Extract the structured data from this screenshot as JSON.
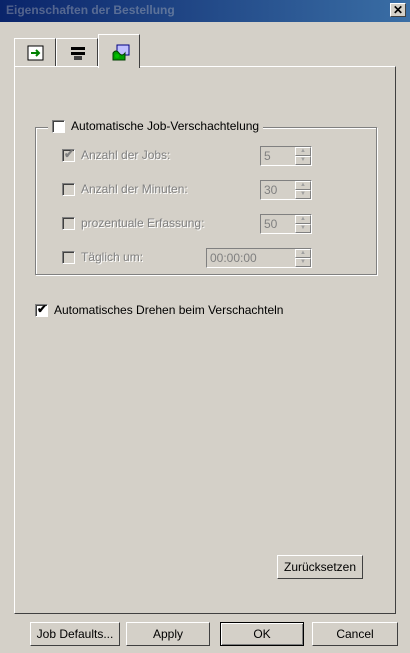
{
  "window": {
    "title": "Eigenschaften der Bestellung",
    "close_symbol": "✕"
  },
  "tabs": [
    {
      "icon": "document-arrow-icon"
    },
    {
      "icon": "printer-icon"
    },
    {
      "icon": "puzzle-settings-icon",
      "active": true
    }
  ],
  "auto_nesting": {
    "label": "Automatische Job-Verschachtelung",
    "checked": false,
    "options": [
      {
        "label": "Anzahl der Jobs:",
        "checked": true,
        "value": "5"
      },
      {
        "label": "Anzahl der Minuten:",
        "checked": false,
        "value": "30"
      },
      {
        "label": "prozentuale Erfassung:",
        "checked": false,
        "value": "50"
      },
      {
        "label": "Täglich um:",
        "checked": false,
        "value": "00:00:00"
      }
    ]
  },
  "auto_rotate": {
    "label": "Automatisches Drehen beim Verschachteln",
    "checked": true
  },
  "buttons": {
    "reset": "Zurücksetzen",
    "job_defaults": "Job Defaults...",
    "apply": "Apply",
    "ok": "OK",
    "cancel": "Cancel"
  },
  "check_symbol": "✔"
}
